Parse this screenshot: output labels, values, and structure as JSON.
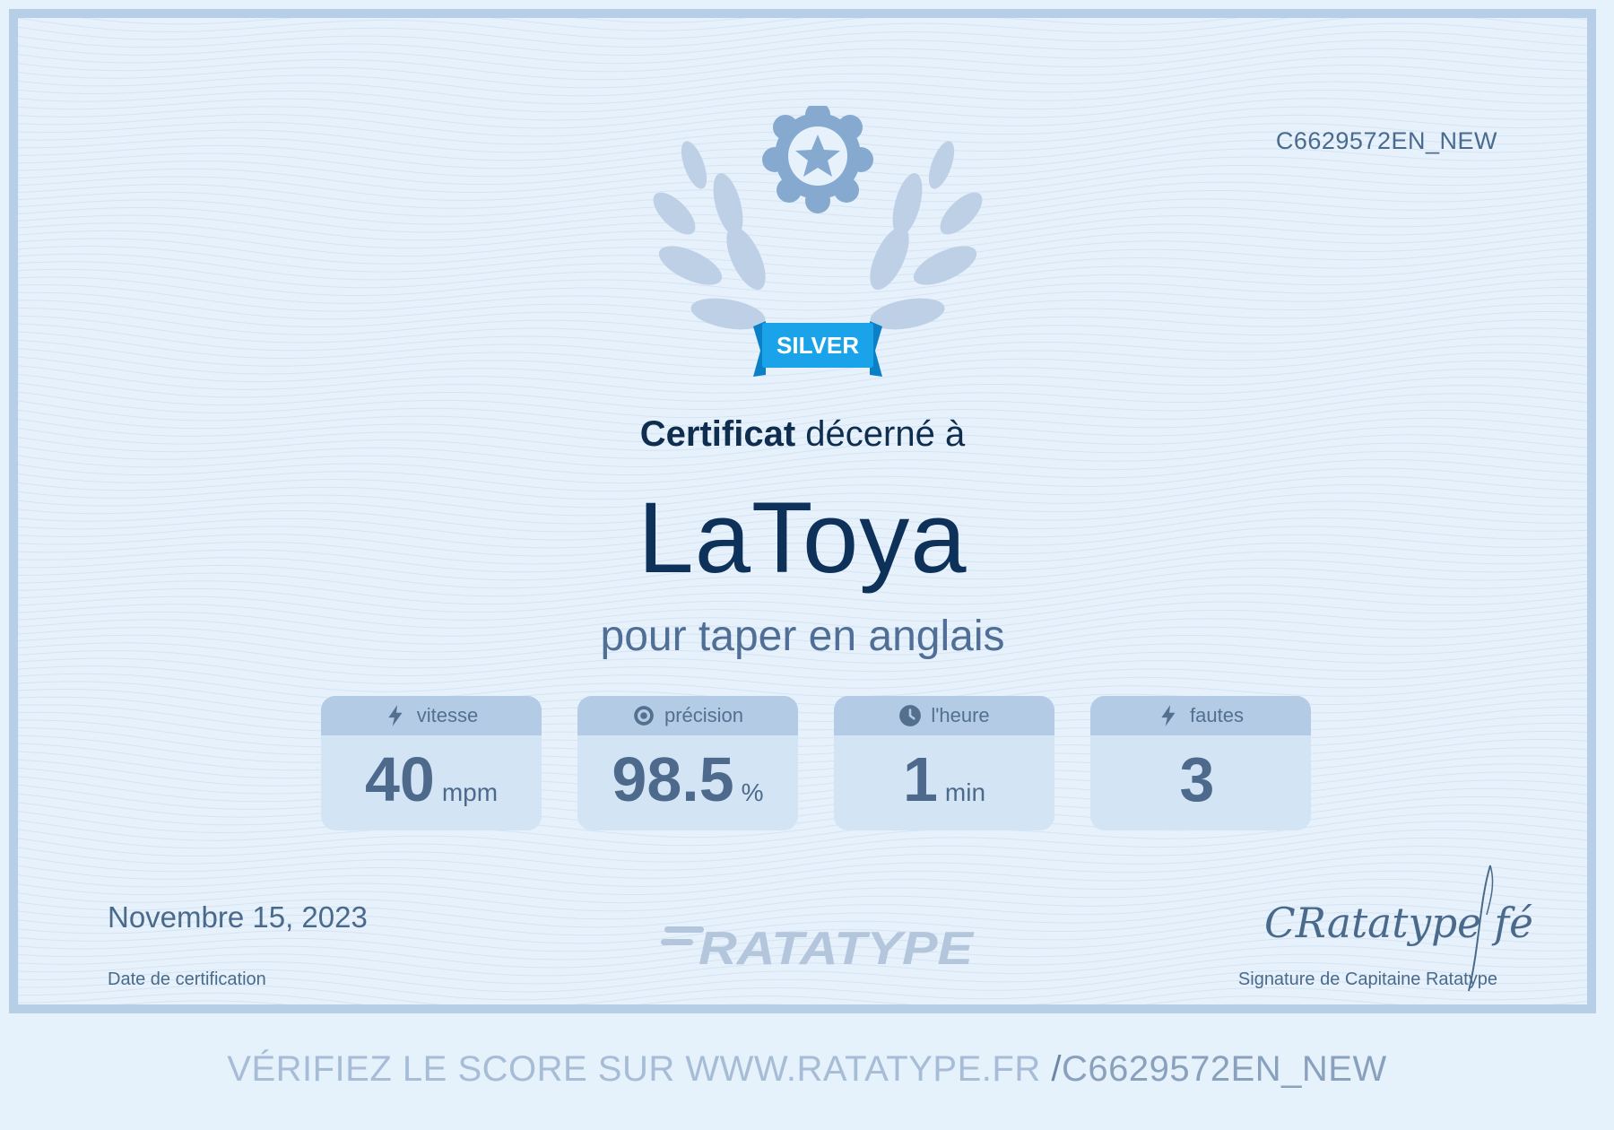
{
  "certificate": {
    "id": "C6629572EN_NEW",
    "badge_level": "SILVER",
    "title_bold": "Certificat",
    "title_rest": "décerné à",
    "recipient": "LaToya",
    "subtitle": "pour taper en anglais",
    "date": "Novembre 15, 2023",
    "date_label": "Date de certification",
    "signature_label": "Signature de Capitaine Ratatype",
    "signature_text": "CRatatype fé",
    "logo": "RATATYPE"
  },
  "stats": [
    {
      "icon": "lightning-icon",
      "label": "vitesse",
      "value": "40",
      "unit": "mpm"
    },
    {
      "icon": "target-icon",
      "label": "précision",
      "value": "98.5",
      "unit": "%"
    },
    {
      "icon": "clock-icon",
      "label": "l'heure",
      "value": "1",
      "unit": "min"
    },
    {
      "icon": "lightning-icon",
      "label": "fautes",
      "value": "3",
      "unit": ""
    }
  ],
  "footer": {
    "verify_text": "VÉRIFIEZ LE SCORE SUR WWW.RATATYPE.FR",
    "slash": "/",
    "verify_code": "C6629572EN_NEW"
  },
  "colors": {
    "background": "#e6f1fb",
    "border": "#b7cfe6",
    "title": "#0d3159",
    "badge_ribbon": "#1ba3ea",
    "badge_medal": "#86a9cf"
  }
}
